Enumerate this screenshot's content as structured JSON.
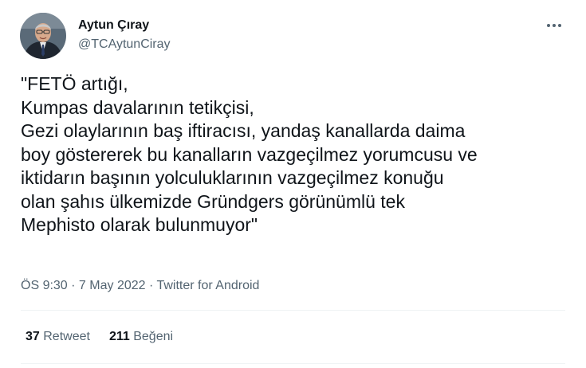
{
  "author": {
    "display_name": "Aytun Çıray",
    "handle": "@TCAytunCiray",
    "avatar_icon": "user-avatar"
  },
  "more_icon": "ellipsis-icon",
  "tweet": {
    "lines": [
      "\"FETÖ artığı,",
      "Kumpas davalarının tetikçisi,",
      "Gezi olaylarının baş iftiracısı, yandaş kanallarda daima",
      "boy göstererek bu kanalların vazgeçilmez yorumcusu ve",
      "iktidarın başının yolculuklarının vazgeçilmez konuğu",
      "olan şahıs ülkemizde Gründgers görünümlü tek",
      "Mephisto olarak bulunmuyor\""
    ]
  },
  "meta": {
    "time": "ÖS 9:30",
    "separator": " · ",
    "date": "7 May 2022",
    "source": "Twitter for Android"
  },
  "stats": {
    "retweets_count": "37",
    "retweets_label": "Retweet",
    "likes_count": "211",
    "likes_label": "Beğeni"
  },
  "colors": {
    "text_primary": "#0f1419",
    "text_secondary": "#536471",
    "divider": "#eff3f4"
  }
}
